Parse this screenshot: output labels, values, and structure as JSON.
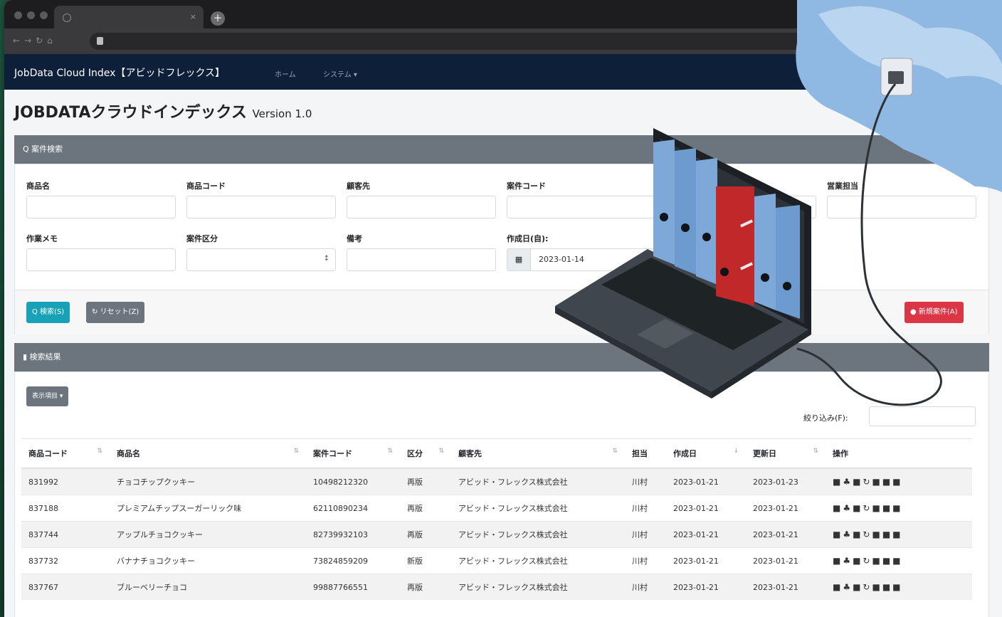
{
  "browser": {
    "tab_title": "",
    "tab_close": "×",
    "new_tab": "+"
  },
  "nav": {
    "brand": "JobData Cloud Index【アビッドフレックス】",
    "home": "ホーム",
    "system": "システム ▾"
  },
  "page": {
    "title": "JOBDATAクラウドインデックス",
    "version": "Version 1.0"
  },
  "search_panel": {
    "header": "Q 案件検索",
    "labels": {
      "product_name": "商品名",
      "product_code": "商品コード",
      "customer": "顧客先",
      "case_code": "案件コード",
      "sales_rep": "営業担当",
      "work_memo": "作業メモ",
      "case_type": "案件区分",
      "remarks": "備考",
      "created_from": "作成日(自):"
    },
    "created_from_value": "2023-01-14",
    "search_button": "Q 検索(S)",
    "reset_button": "↻ リセット(Z)",
    "new_button": "● 新規案件(A)"
  },
  "results_panel": {
    "header": "▮ 検索結果",
    "columns_button": "表示項目 ▾",
    "filter_label": "絞り込み(F):",
    "columns": [
      "商品コード",
      "商品名",
      "案件コード",
      "区分",
      "顧客先",
      "担当",
      "作成日",
      "更新日",
      "操作"
    ],
    "rows": [
      {
        "product_code": "831992",
        "product_name": "チョコチップクッキー",
        "case_code": "10498212320",
        "type": "再版",
        "customer": "アビッド・フレックス株式会社",
        "rep": "川村",
        "created": "2023-01-21",
        "updated": "2023-01-23",
        "ops": "■♣■↻■■■"
      },
      {
        "product_code": "837188",
        "product_name": "プレミアムチップスーガーリック味",
        "case_code": "62110890234",
        "type": "再版",
        "customer": "アビッド・フレックス株式会社",
        "rep": "川村",
        "created": "2023-01-21",
        "updated": "2023-01-21",
        "ops": "■♣■↻■■■"
      },
      {
        "product_code": "837744",
        "product_name": "アップルチョコクッキー",
        "case_code": "82739932103",
        "type": "再版",
        "customer": "アビッド・フレックス株式会社",
        "rep": "川村",
        "created": "2023-01-21",
        "updated": "2023-01-21",
        "ops": "■♣■↻■■■"
      },
      {
        "product_code": "837732",
        "product_name": "バナナチョコクッキー",
        "case_code": "73824859209",
        "type": "新版",
        "customer": "アビッド・フレックス株式会社",
        "rep": "川村",
        "created": "2023-01-21",
        "updated": "2023-01-21",
        "ops": "■♣■↻■■■"
      },
      {
        "product_code": "837767",
        "product_name": "ブルーベリーチョコ",
        "case_code": "99887766551",
        "type": "再版",
        "customer": "アビッド・フレックス株式会社",
        "rep": "川村",
        "created": "2023-01-21",
        "updated": "2023-01-21",
        "ops": "■♣■↻■■■"
      }
    ]
  },
  "colors": {
    "navbar": "#0e1f3a",
    "panel_header": "#6c757d",
    "search_button": "#17a2b8",
    "new_button": "#dc3545",
    "binder_blue": "#7ea8d8",
    "binder_red": "#c0282a",
    "cloud": "#8fb9e3"
  },
  "icons": [
    "search-icon",
    "reset-icon",
    "plus-circle-icon",
    "document-icon",
    "calendar-icon",
    "folder-icon",
    "user-icon",
    "edit-icon",
    "history-icon",
    "copy-icon",
    "print-icon",
    "trash-icon",
    "cloud-icon",
    "laptop-icon",
    "binder-icon",
    "power-plug-icon"
  ]
}
